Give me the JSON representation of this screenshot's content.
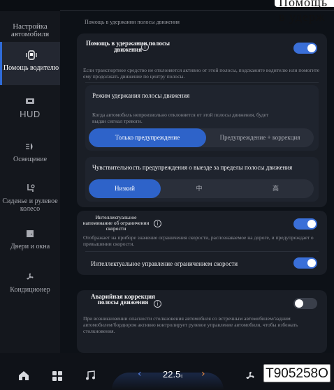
{
  "top_cut_text": "Помощь в удерж",
  "sidebar": {
    "title": "Настройка автомобиля",
    "items": [
      {
        "label": "Помощь водителю",
        "icon": "driver-assist-icon",
        "active": true
      },
      {
        "label": "HUD",
        "icon": "hud-icon",
        "active": false
      },
      {
        "label": "Освещение",
        "icon": "headlight-icon",
        "active": false
      },
      {
        "label": "Сиденье и рулевое колесо",
        "icon": "seat-icon",
        "active": false
      },
      {
        "label": "Двери и окна",
        "icon": "door-icon",
        "active": false
      },
      {
        "label": "Кондиционер",
        "icon": "fan-icon",
        "active": false
      }
    ]
  },
  "breadcrumb": "Помощь в удержании полосы движения",
  "lane_assist": {
    "title": "Помощь в удержании полосы движения",
    "enabled": true,
    "description": "Если транспортное средство не отклоняется активно от этой полосы, подскажите водителю или помогите ему продолжать движение по центру полосы.",
    "mode": {
      "title": "Режим удержания полосы движения",
      "description": "Когда автомобиль непроизвольно отклоняется от этой полосы движения, будет выдан сигнал тревоги.",
      "options": [
        "Только предупреждение",
        "Предупреждение + коррекция"
      ],
      "selected": "Только предупреждение"
    },
    "sensitivity": {
      "title": "Чувствительность предупреждения о выезде за пределы полосы движения",
      "options": [
        "Низкий",
        "中",
        "高"
      ],
      "selected": "Низкий"
    }
  },
  "speed_limit": {
    "title": "Интеллектуальное напоминание об ограничении скорости",
    "enabled": true,
    "description": "Отображает на приборе значение ограничения скорости, распознаваемое на дороге, и предупреждает о превышении скорости.",
    "control_label": "Интеллектуальное управление ограничением скорости",
    "control_enabled": true
  },
  "emergency": {
    "title": "Аварийная коррекция полосы движения",
    "enabled": false,
    "description": "При возникновении опасности столкновения автомобиля со встречным автомобилем/задним автомобилем/бордюром активно контролирует рулевое управление автомобиля, чтобы избежать столкновения."
  },
  "bottom_bar": {
    "temperature": "22.5",
    "temperature_unit": "c",
    "plate": "T905258O",
    "icons": [
      "home-icon",
      "apps-grid-icon",
      "music-icon",
      "fan-icon"
    ],
    "accent_colors": {
      "active": "#2f6bd8",
      "left_arrow": "#5b88f0",
      "right_arrow": "#f08a3c"
    }
  }
}
